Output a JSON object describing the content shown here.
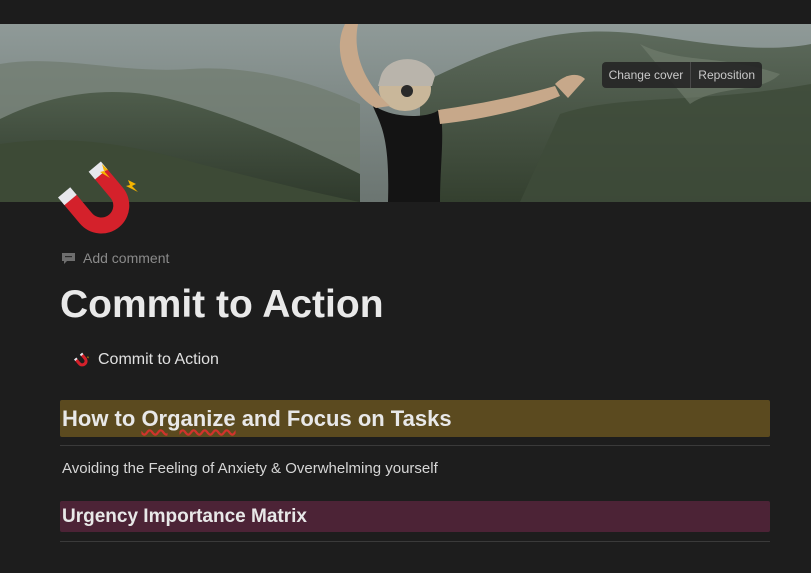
{
  "cover": {
    "change_label": "Change cover",
    "reposition_label": "Reposition"
  },
  "page": {
    "icon": "magnet-icon",
    "add_comment_label": "Add comment",
    "title": "Commit to Action",
    "subpage_link_label": "Commit to Action"
  },
  "blocks": {
    "heading1_prefix": "How to ",
    "heading1_underlined": "Organize",
    "heading1_suffix": " and Focus on Tasks",
    "paragraph1": "Avoiding the Feeling of Anxiety & Overwhelming yourself",
    "heading2": "Urgency Importance Matrix"
  },
  "colors": {
    "background": "#1d1d1d",
    "callout_brown": "#5b4a1f",
    "callout_purple": "#4c2336",
    "spellcheck_red": "#d2332c"
  }
}
